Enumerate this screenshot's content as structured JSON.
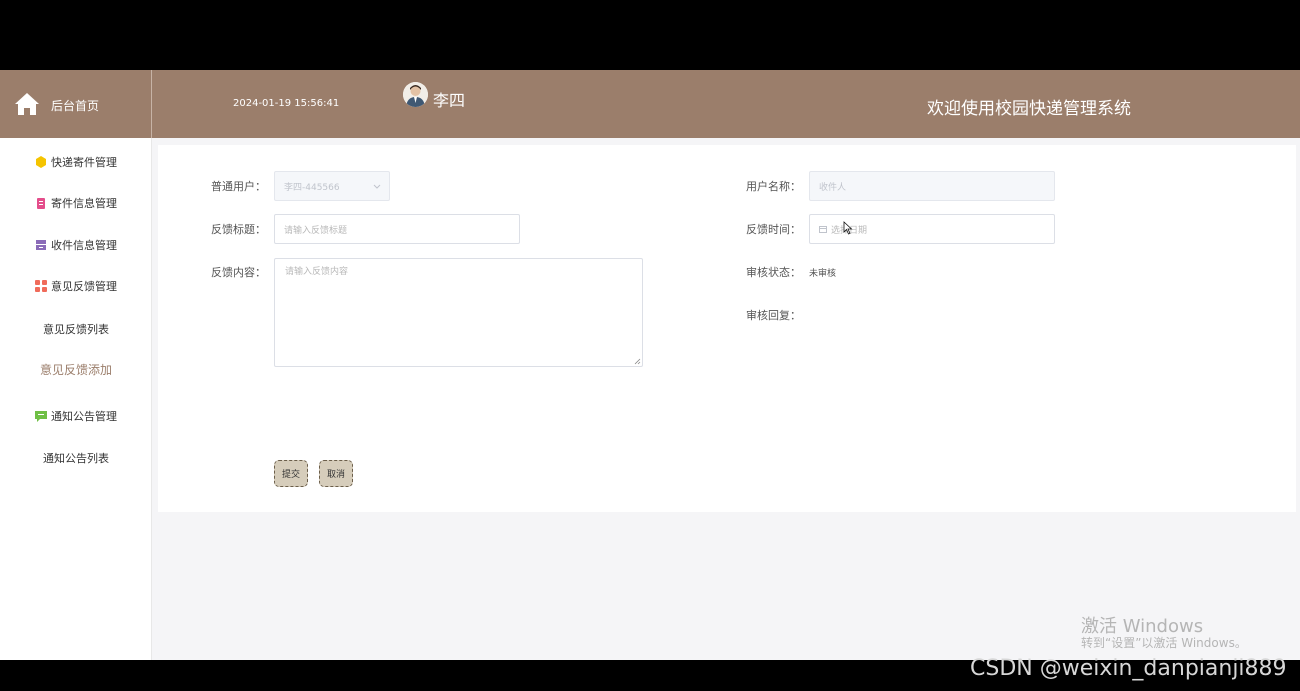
{
  "topbar": {
    "home_label": "后台首页",
    "datetime": "2024-01-19 15:56:41",
    "username": "李四",
    "welcome": "欢迎使用校园快递管理系统"
  },
  "sidebar": {
    "items": [
      {
        "label": "快递寄件管理",
        "icon": "cube-icon",
        "color": "#f5c400"
      },
      {
        "label": "寄件信息管理",
        "icon": "clipboard-icon",
        "color": "#e44d8b"
      },
      {
        "label": "收件信息管理",
        "icon": "archive-box-icon",
        "color": "#8a6bb8"
      },
      {
        "label": "意见反馈管理",
        "icon": "grid-icon",
        "color": "#f06b5a"
      },
      {
        "label": "意见反馈列表"
      },
      {
        "label": "意见反馈添加"
      },
      {
        "label": "通知公告管理",
        "icon": "message-icon",
        "color": "#6fbf45"
      },
      {
        "label": "通知公告列表"
      }
    ]
  },
  "form": {
    "user_label": "普通用户：",
    "user_value": "李四-445566",
    "title_label": "反馈标题：",
    "title_placeholder": "请输入反馈标题",
    "content_label": "反馈内容：",
    "content_placeholder": "请输入反馈内容",
    "username_label": "用户名称：",
    "username_placeholder": "收件人",
    "time_label": "反馈时间：",
    "time_placeholder": "选择日期",
    "status_label": "审核状态：",
    "status_value": "未审核",
    "reply_label": "审核回复：",
    "submit": "提交",
    "cancel": "取消"
  },
  "overlay": {
    "windows_title": "激活 Windows",
    "windows_sub": "转到“设置”以激活 Windows。",
    "csdn": "CSDN @weixin_danpianji889"
  }
}
